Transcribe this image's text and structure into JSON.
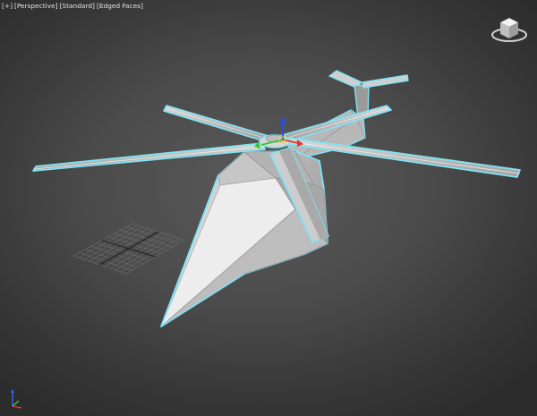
{
  "viewport": {
    "labels": [
      "[+]",
      "[Perspective]",
      "[Standard]",
      "[Edged Faces]"
    ]
  },
  "scene": {
    "object": "helicopter",
    "shading": "edged-faces",
    "selection_color": "#7fe3f5",
    "mesh_color": "#c8c8c8",
    "grid_color": "#6f6f6f"
  },
  "icons": {
    "viewcube": "viewcube-icon",
    "gizmo": "transform-gizmo-icon",
    "axis": "axis-tripod-icon"
  }
}
